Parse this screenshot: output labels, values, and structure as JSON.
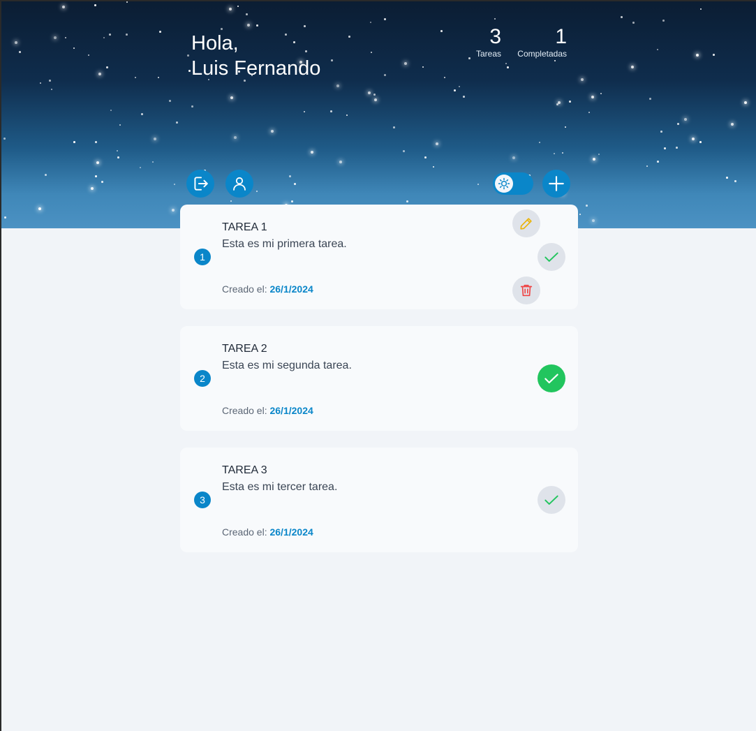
{
  "header": {
    "greeting_line1": "Hola,",
    "greeting_line2": "Luis Fernando",
    "stats": {
      "tasks_count": "3",
      "tasks_label": "Tareas",
      "completed_count": "1",
      "completed_label": "Completadas"
    }
  },
  "toolbar": {
    "logout_icon": "logout-icon",
    "profile_icon": "user-icon",
    "theme_toggle_icon": "sun-icon",
    "add_icon": "plus-icon"
  },
  "created_label": "Creado el:",
  "tasks": [
    {
      "index": "1",
      "title": "TAREA 1",
      "description": "Esta es mi primera tarea.",
      "created_date": "26/1/2024",
      "completed": false,
      "show_edit_delete": true
    },
    {
      "index": "2",
      "title": "TAREA 2",
      "description": "Esta es mi segunda tarea.",
      "created_date": "26/1/2024",
      "completed": true,
      "show_edit_delete": false
    },
    {
      "index": "3",
      "title": "TAREA 3",
      "description": "Esta es mi tercer tarea.",
      "created_date": "26/1/2024",
      "completed": false,
      "show_edit_delete": false
    }
  ],
  "colors": {
    "accent": "#0a86c9",
    "success": "#22c55e",
    "edit": "#eab308",
    "danger": "#ef4444"
  }
}
